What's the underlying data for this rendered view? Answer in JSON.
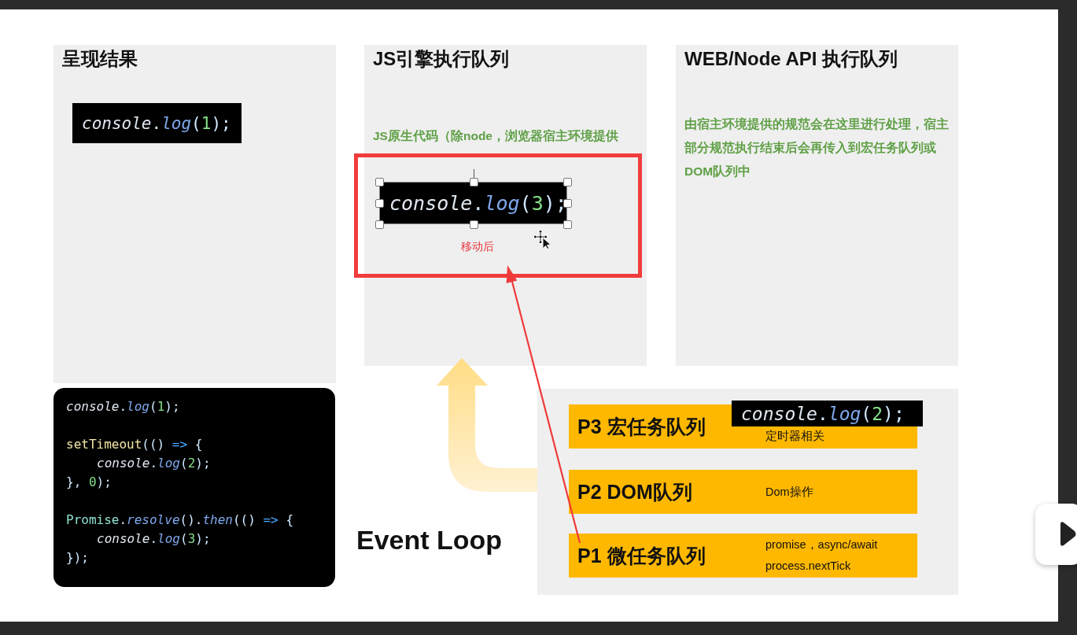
{
  "panels": [
    {
      "title": "呈现结果"
    },
    {
      "title": "JS引擎执行队列",
      "note": "JS原生代码（除node，浏览器宿主环境提供"
    },
    {
      "title": "WEB/Node API 执行队列",
      "note": "由宿主环境提供的规范会在这里进行处理，宿主部分规范执行结束后会再传入到宏任务队列或DOM队列中"
    }
  ],
  "snippets": [
    {
      "selected": false,
      "tokens": [
        {
          "text": "console",
          "kind": "obj"
        },
        {
          "text": ".",
          "kind": "punct"
        },
        {
          "text": "log",
          "kind": "method"
        },
        {
          "text": "(",
          "kind": "punct"
        },
        {
          "text": "1",
          "kind": "num"
        },
        {
          "text": ");",
          "kind": "punct"
        }
      ]
    },
    {
      "selected": true,
      "tokens": [
        {
          "text": "console",
          "kind": "obj"
        },
        {
          "text": ".",
          "kind": "punct"
        },
        {
          "text": "log",
          "kind": "method"
        },
        {
          "text": "(",
          "kind": "punct"
        },
        {
          "text": "3",
          "kind": "num"
        },
        {
          "text": ");",
          "kind": "punct"
        }
      ]
    },
    {
      "selected": false,
      "tokens": [
        {
          "text": "console",
          "kind": "obj"
        },
        {
          "text": ".",
          "kind": "punct"
        },
        {
          "text": "log",
          "kind": "method"
        },
        {
          "text": "(",
          "kind": "punct"
        },
        {
          "text": "2",
          "kind": "num"
        },
        {
          "text": ");",
          "kind": "punct"
        }
      ]
    }
  ],
  "moved_label": "移动后",
  "code_block": {
    "groups": [
      {
        "lines": [
          {
            "indented": false,
            "tokens": [
              {
                "text": "console",
                "kind": "obj"
              },
              {
                "text": ".",
                "kind": "punct"
              },
              {
                "text": "log",
                "kind": "method"
              },
              {
                "text": "(",
                "kind": "punct"
              },
              {
                "text": "1",
                "kind": "num"
              },
              {
                "text": ");",
                "kind": "punct"
              }
            ]
          }
        ]
      },
      {
        "lines": [
          {
            "indented": false,
            "tokens": [
              {
                "text": "setTimeout",
                "kind": "func"
              },
              {
                "text": "(() ",
                "kind": "punct"
              },
              {
                "text": "=>",
                "kind": "arrow"
              },
              {
                "text": " {",
                "kind": "punct"
              }
            ]
          },
          {
            "indented": true,
            "tokens": [
              {
                "text": "console",
                "kind": "obj"
              },
              {
                "text": ".",
                "kind": "punct"
              },
              {
                "text": "log",
                "kind": "method"
              },
              {
                "text": "(",
                "kind": "punct"
              },
              {
                "text": "2",
                "kind": "num"
              },
              {
                "text": ");",
                "kind": "punct"
              }
            ]
          },
          {
            "indented": false,
            "tokens": [
              {
                "text": "}, ",
                "kind": "punct"
              },
              {
                "text": "0",
                "kind": "num"
              },
              {
                "text": ");",
                "kind": "punct"
              }
            ]
          }
        ]
      },
      {
        "lines": [
          {
            "indented": false,
            "tokens": [
              {
                "text": "Promise",
                "kind": "class"
              },
              {
                "text": ".",
                "kind": "punct"
              },
              {
                "text": "resolve",
                "kind": "method"
              },
              {
                "text": "().",
                "kind": "punct"
              },
              {
                "text": "then",
                "kind": "method"
              },
              {
                "text": "(() ",
                "kind": "punct"
              },
              {
                "text": "=>",
                "kind": "arrow"
              },
              {
                "text": " {",
                "kind": "punct"
              }
            ]
          },
          {
            "indented": true,
            "tokens": [
              {
                "text": "console",
                "kind": "obj"
              },
              {
                "text": ".",
                "kind": "punct"
              },
              {
                "text": "log",
                "kind": "method"
              },
              {
                "text": "(",
                "kind": "punct"
              },
              {
                "text": "3",
                "kind": "num"
              },
              {
                "text": ");",
                "kind": "punct"
              }
            ]
          },
          {
            "indented": false,
            "tokens": [
              {
                "text": "});",
                "kind": "punct"
              }
            ]
          }
        ]
      }
    ]
  },
  "event_loop_label": "Event Loop",
  "queues": [
    {
      "name": "P3 宏任务队列",
      "notes": [
        "定时器相关"
      ]
    },
    {
      "name": "P2 DOM队列",
      "notes": [
        "Dom操作"
      ]
    },
    {
      "name": "P1 微任务队列",
      "notes": [
        "promise，async/await",
        "process.nextTick"
      ]
    }
  ]
}
